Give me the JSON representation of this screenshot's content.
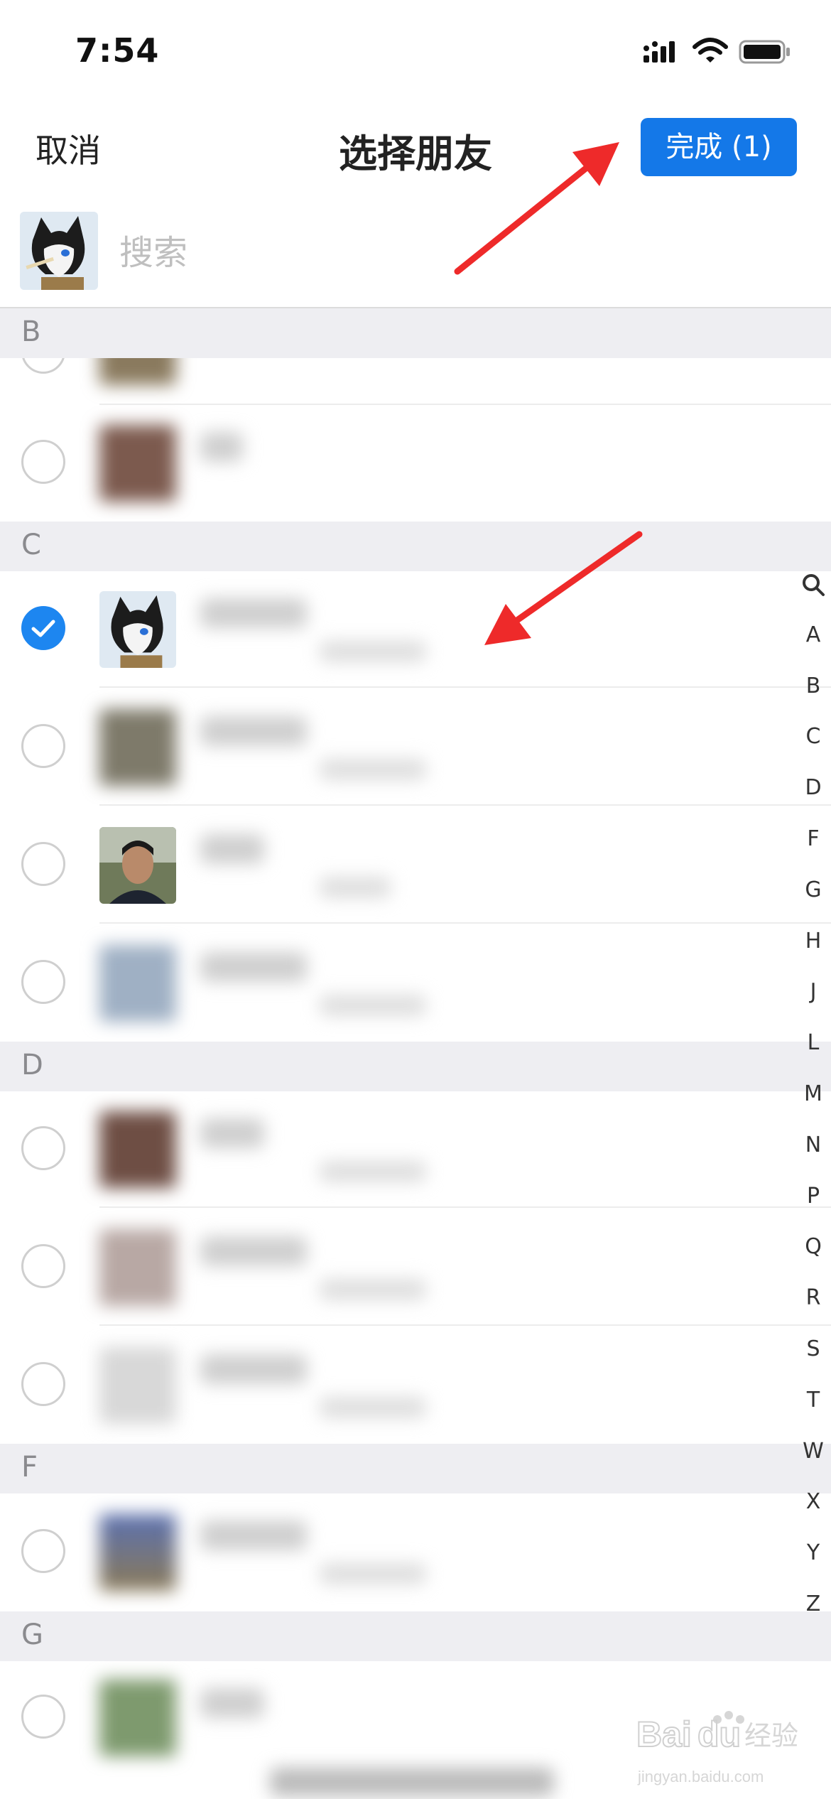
{
  "status_bar": {
    "time": "7:54"
  },
  "nav": {
    "cancel": "取消",
    "title": "选择朋友",
    "done": "完成 (1)"
  },
  "search": {
    "placeholder": "搜索"
  },
  "sections": [
    {
      "letter": "B"
    },
    {
      "letter": "C"
    },
    {
      "letter": "D"
    },
    {
      "letter": "F"
    },
    {
      "letter": "G"
    }
  ],
  "index_letters": [
    "Q",
    "A",
    "B",
    "C",
    "D",
    "F",
    "G",
    "H",
    "J",
    "L",
    "M",
    "N",
    "P",
    "Q",
    "R",
    "S",
    "T",
    "W",
    "X",
    "Y",
    "Z"
  ],
  "selected_count": 1,
  "colors": {
    "accent": "#1478e8",
    "annotation": "#ee2a2a"
  },
  "watermark": {
    "brand": "Baidu经验",
    "url": "jingyan.baidu.com"
  }
}
